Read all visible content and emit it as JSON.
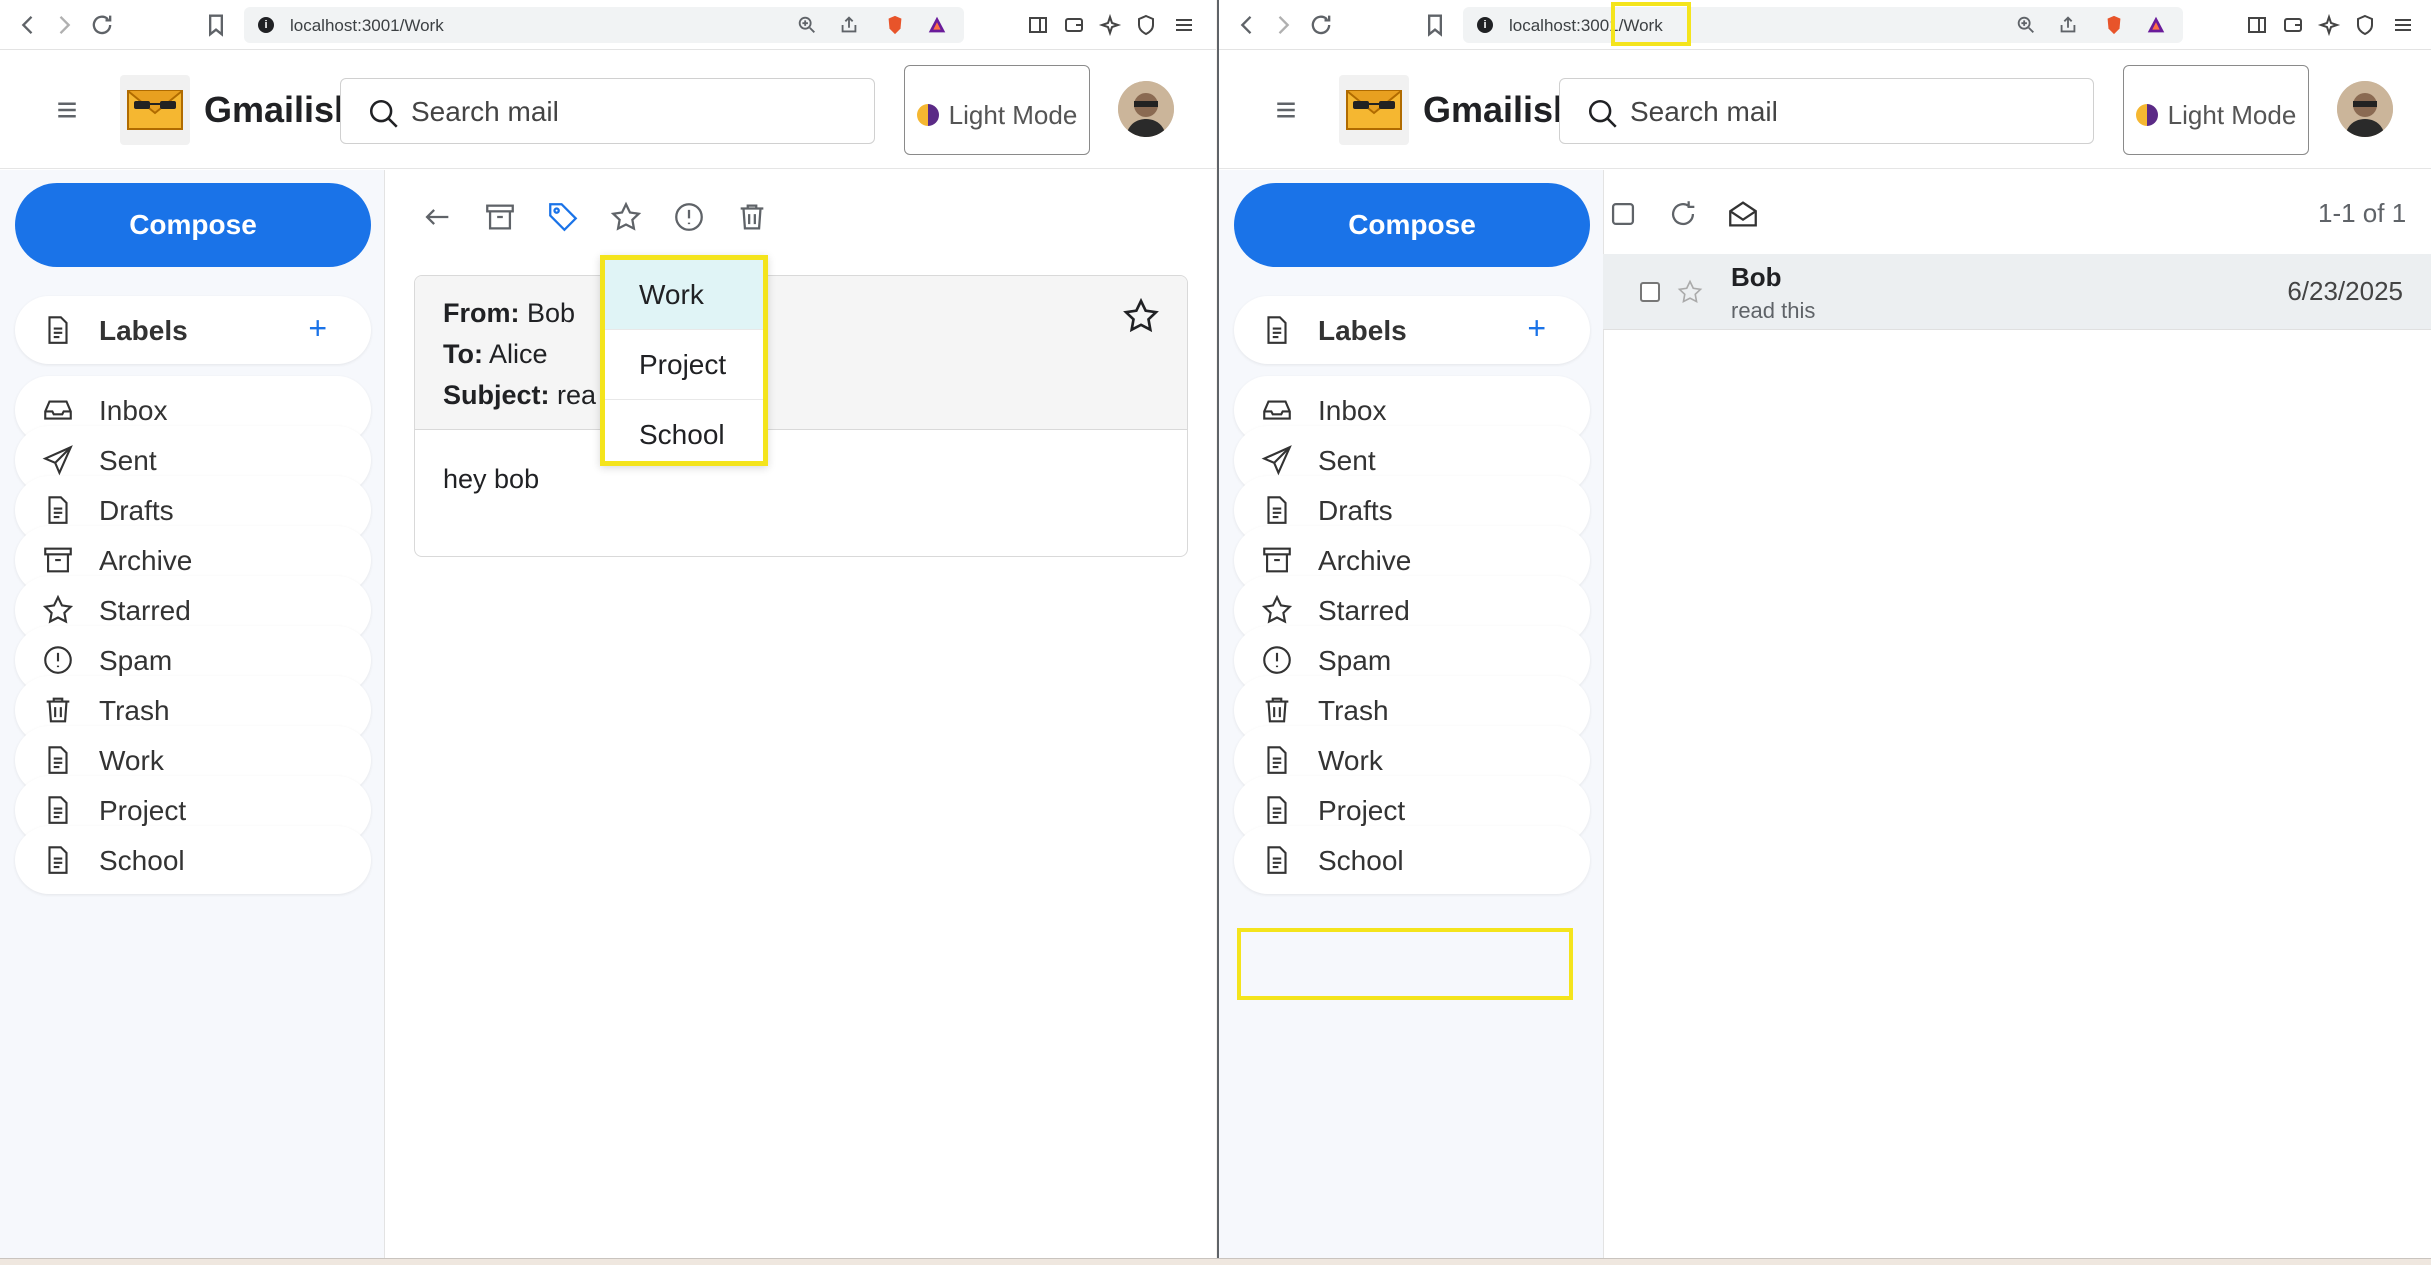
{
  "browser": {
    "url": "localhost:3001/Work"
  },
  "app": {
    "brand": "Gmailish",
    "search_placeholder": "Search mail",
    "mode_label": "Light Mode",
    "compose_label": "Compose"
  },
  "sidebar": {
    "labels_header": "Labels",
    "add_label": "+",
    "items": [
      {
        "label": "Inbox",
        "icon": "inbox-icon"
      },
      {
        "label": "Sent",
        "icon": "send-icon"
      },
      {
        "label": "Drafts",
        "icon": "file-icon"
      },
      {
        "label": "Archive",
        "icon": "archive-icon"
      },
      {
        "label": "Starred",
        "icon": "star-icon"
      },
      {
        "label": "Spam",
        "icon": "alert-circle-icon"
      },
      {
        "label": "Trash",
        "icon": "trash-icon"
      },
      {
        "label": "Work",
        "icon": "file-icon"
      },
      {
        "label": "Project",
        "icon": "file-icon"
      },
      {
        "label": "School",
        "icon": "file-icon"
      }
    ]
  },
  "message_view": {
    "from_label": "From:",
    "from_value": "Bob",
    "to_label": "To:",
    "to_value": "Alice",
    "subject_label": "Subject:",
    "subject_value": "rea",
    "body": "hey bob",
    "label_menu": [
      "Work",
      "Project",
      "School"
    ],
    "label_menu_active": "Work"
  },
  "list_view": {
    "pager": "1-1 of 1",
    "rows": [
      {
        "sender": "Bob",
        "subject": "read this",
        "date": "6/23/2025"
      }
    ]
  },
  "colors": {
    "accent": "#1a73e8",
    "highlight": "#f4e41c",
    "menu_active": "#e0f4f6"
  }
}
